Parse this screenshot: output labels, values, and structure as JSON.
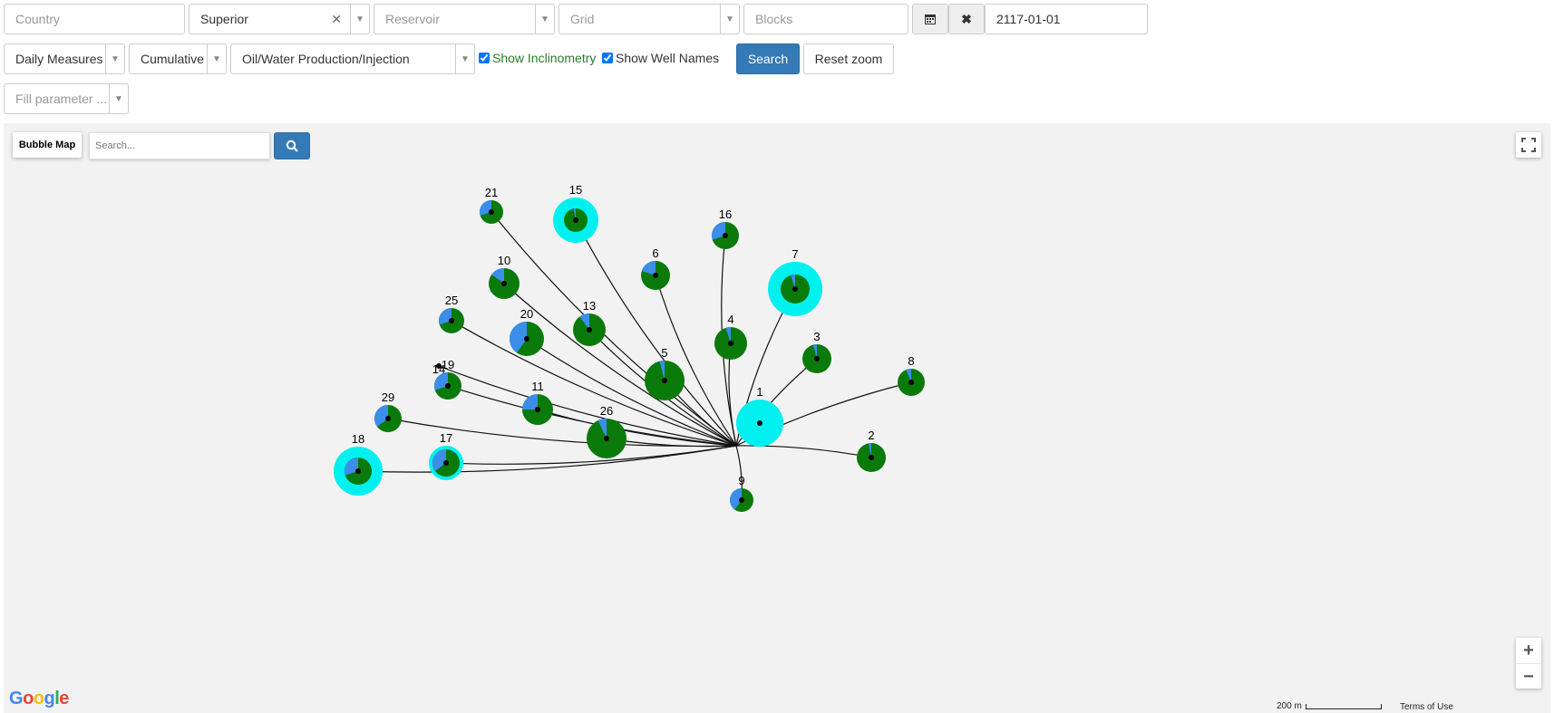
{
  "filters": {
    "country_placeholder": "Country",
    "field_value": "Superior",
    "reservoir_placeholder": "Reservoir",
    "grid_placeholder": "Grid",
    "blocks_placeholder": "Blocks",
    "date_value": "2117-01-01"
  },
  "options": {
    "measure_value": "Daily Measures",
    "mode_value": "Cumulative",
    "production_value": "Oil/Water Production/Injection",
    "show_inclinometry_label": "Show Inclinometry",
    "show_inclinometry_checked": true,
    "show_well_names_label": "Show Well Names",
    "show_well_names_checked": true,
    "search_label": "Search",
    "reset_zoom_label": "Reset zoom",
    "fill_parameter_placeholder": "Fill parameter ..."
  },
  "map": {
    "bubble_map_label": "Bubble Map",
    "search_placeholder": "Search...",
    "google_label": "Google",
    "scale_label": "200 m",
    "terms_label": "Terms of Use",
    "zoom_in": "+",
    "zoom_out": "−",
    "colors": {
      "oil": "#0a7a0a",
      "water": "#3b8eea",
      "injection": "#00f0f0"
    },
    "wells": [
      {
        "name": "1",
        "water": 0.0,
        "injection": true
      },
      {
        "name": "2",
        "water": 0.03
      },
      {
        "name": "3",
        "water": 0.04
      },
      {
        "name": "4",
        "water": 0.05
      },
      {
        "name": "5",
        "water": 0.04
      },
      {
        "name": "6",
        "water": 0.2
      },
      {
        "name": "7",
        "water": 0.05,
        "injection": true
      },
      {
        "name": "8",
        "water": 0.06
      },
      {
        "name": "9",
        "water": 0.4
      },
      {
        "name": "10",
        "water": 0.15
      },
      {
        "name": "11",
        "water": 0.25
      },
      {
        "name": "13",
        "water": 0.1
      },
      {
        "name": "14"
      },
      {
        "name": "15",
        "water": 0.03,
        "injection": true
      },
      {
        "name": "16",
        "water": 0.3
      },
      {
        "name": "17",
        "water": 0.35,
        "injection": true
      },
      {
        "name": "18",
        "water": 0.3,
        "injection": true
      },
      {
        "name": "19",
        "water": 0.3
      },
      {
        "name": "20",
        "water": 0.4
      },
      {
        "name": "21",
        "water": 0.3
      },
      {
        "name": "25",
        "water": 0.3
      },
      {
        "name": "26",
        "water": 0.07
      },
      {
        "name": "29",
        "water": 0.35
      }
    ]
  }
}
